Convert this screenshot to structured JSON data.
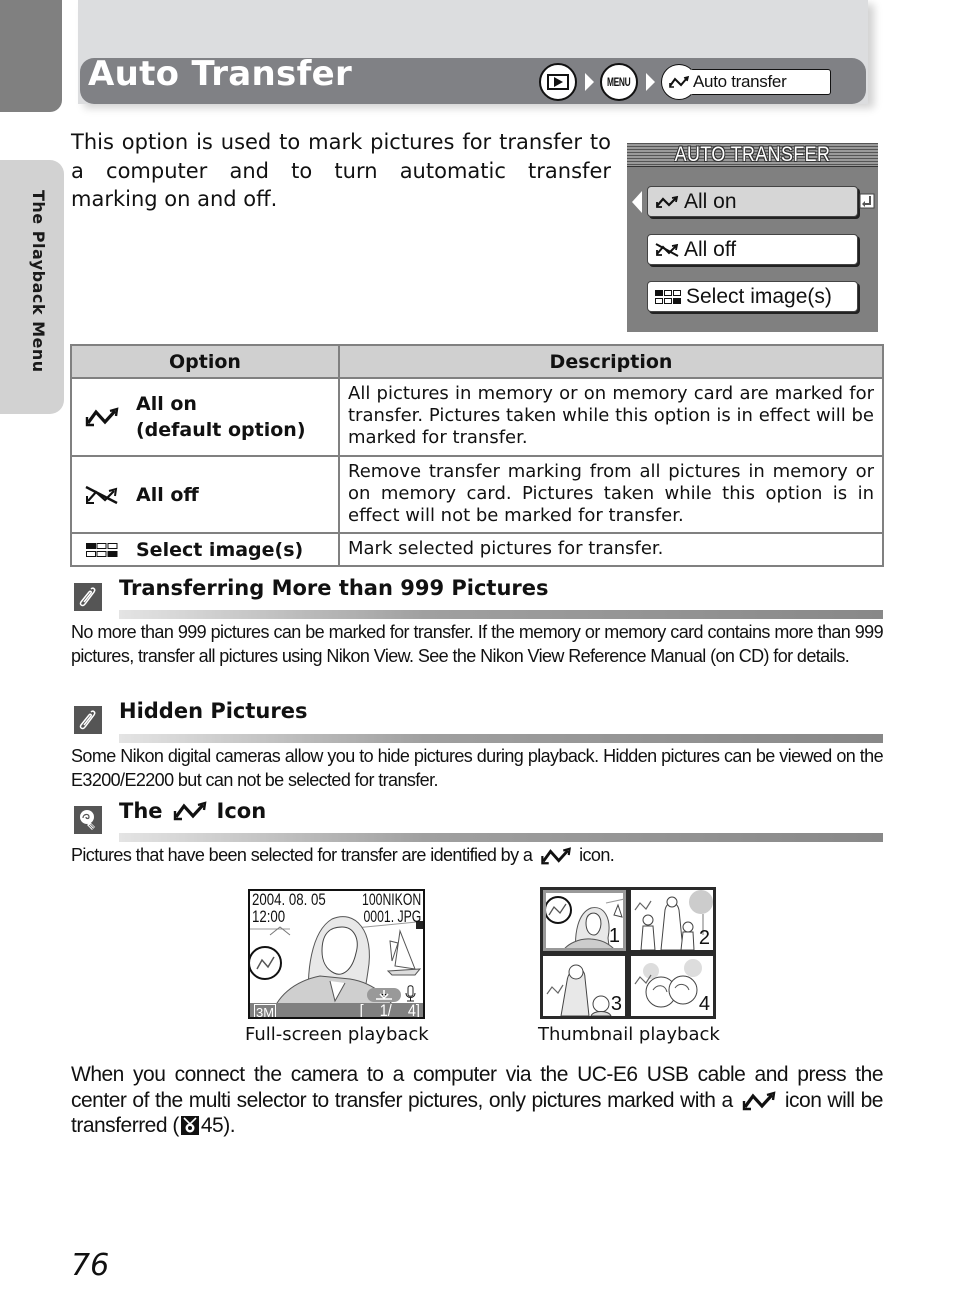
{
  "side_tab": {
    "label": "The Playback Menu"
  },
  "header": {
    "title": "Auto Transfer",
    "breadcrumb": {
      "step1_icon": "playback-icon",
      "step2_label": "MENU",
      "step3_icon": "transfer-icon",
      "step3_label": "Auto transfer"
    }
  },
  "intro": "This option is used to mark pictures for transfer to a computer and to turn automatic transfer marking on and off.",
  "camera_menu": {
    "title": "AUTO TRANSFER",
    "items": [
      {
        "icon": "transfer-icon",
        "label": "All on",
        "selected": true
      },
      {
        "icon": "transfer-off-icon",
        "label": "All off",
        "selected": false
      },
      {
        "icon": "thumbnail-grid-icon",
        "label": "Select image(s)",
        "selected": false
      }
    ]
  },
  "table": {
    "headers": [
      "Option",
      "Description"
    ],
    "rows": [
      {
        "icon": "transfer-icon",
        "option": "All on",
        "option_sub": "(default option)",
        "description": "All pictures in memory or on memory card are marked for transfer. Pictures taken while this option is in effect will be marked for transfer."
      },
      {
        "icon": "transfer-off-icon",
        "option": "All off",
        "option_sub": "",
        "description": "Remove transfer marking from all pictures in memory or on memory card. Pictures taken while this option is in effect will not be marked for transfer."
      },
      {
        "icon": "thumbnail-grid-icon",
        "option": "Select image(s)",
        "option_sub": "",
        "description": "Mark selected pictures for transfer."
      }
    ]
  },
  "notes": [
    {
      "icon": "paperclip-icon",
      "heading": "Transferring More than 999 Pictures",
      "body": "No more than 999 pictures can be marked for transfer. If the memory or memory card contains more than 999 pictures, transfer all pictures using Nikon View. See the Nikon View Reference Manual (on CD) for details."
    },
    {
      "icon": "paperclip-icon",
      "heading": "Hidden Pictures",
      "body": "Some Nikon digital cameras allow you to hide pictures during playback. Hidden pictures can be viewed on the E3200/E2200 but can not be selected for transfer."
    },
    {
      "icon": "lightbulb-icon",
      "heading_pre": "The",
      "heading_post": "Icon",
      "body_pre": "Pictures that have been selected for transfer are identified by a",
      "body_post": "icon."
    }
  ],
  "fullscreen": {
    "date": "2004. 08. 05",
    "time": "12:00",
    "folder": "100NIKON",
    "file": "0001. JPG",
    "image_mode": "3M",
    "counter": "[    1/    4]",
    "caption": "Full-screen playback"
  },
  "thumbnails": {
    "numbers": [
      "1",
      "2",
      "3",
      "4"
    ],
    "caption": "Thumbnail playback"
  },
  "final_paragraph": {
    "part1": "When you connect the camera to a computer via the UC-E6 USB cable and press the center of the multi selector to transfer pictures, only pictures marked with a",
    "part2": "icon will be transferred (",
    "ref_page": "45",
    "part3": ")."
  },
  "page_number": "76"
}
